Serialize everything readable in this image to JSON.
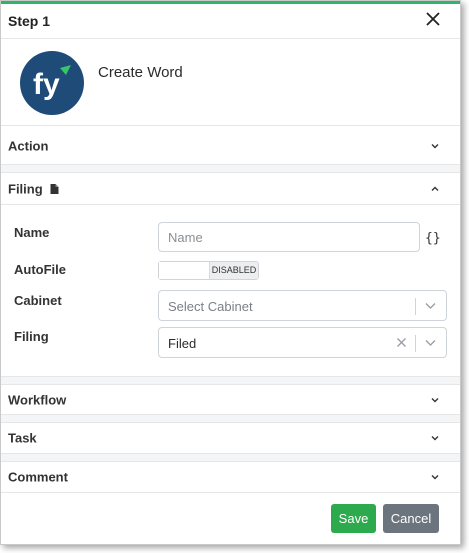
{
  "dialog": {
    "title": "Step 1"
  },
  "app": {
    "logo_text": "fy",
    "name": "Create Word"
  },
  "sections": {
    "action": "Action",
    "filing": "Filing",
    "workflow": "Workflow",
    "task": "Task",
    "comment": "Comment"
  },
  "filing": {
    "name_label": "Name",
    "name_placeholder": "Name",
    "name_value": "",
    "variables_symbol": "{}",
    "autofile_label": "AutoFile",
    "autofile_state": "DISABLED",
    "autofile_enabled": false,
    "cabinet_label": "Cabinet",
    "cabinet_placeholder": "Select Cabinet",
    "filing_label": "Filing",
    "filing_value": "Filed"
  },
  "footer": {
    "save_label": "Save",
    "cancel_label": "Cancel"
  },
  "colors": {
    "accent": "#2fb56a",
    "logo_bg": "#1f4b79",
    "save": "#2eaa4e",
    "cancel": "#6c757d"
  },
  "icons": {
    "close": "close-icon",
    "document": "document-icon",
    "chevron": "chevron-down-icon",
    "clear": "clear-icon"
  }
}
